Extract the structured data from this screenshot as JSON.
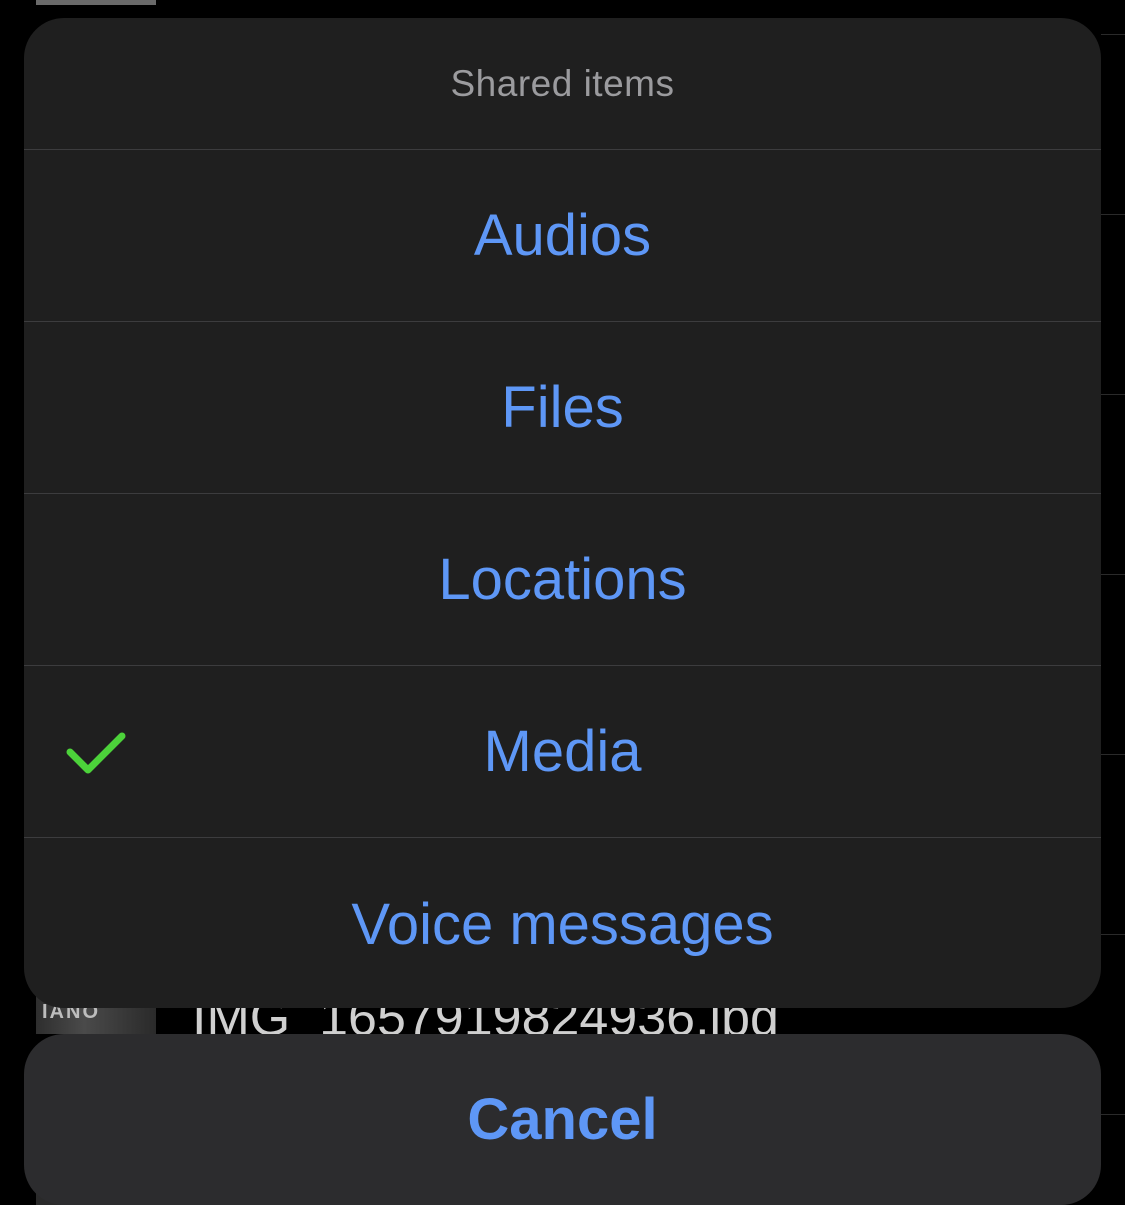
{
  "background": {
    "thumbnail_text": "IANO",
    "filename": "IMG_1657919824936.jpg"
  },
  "action_sheet": {
    "title": "Shared items",
    "items": [
      {
        "label": "Audios",
        "selected": false
      },
      {
        "label": "Files",
        "selected": false
      },
      {
        "label": "Locations",
        "selected": false
      },
      {
        "label": "Media",
        "selected": true
      },
      {
        "label": "Voice messages",
        "selected": false
      }
    ],
    "cancel_label": "Cancel"
  },
  "colors": {
    "accent": "#5e97f6",
    "check": "#4cd23a",
    "sheet_bg": "#1f1f1f",
    "cancel_bg": "#2c2c2e"
  },
  "icons": {
    "selected_indicator": "checkmark-icon"
  }
}
